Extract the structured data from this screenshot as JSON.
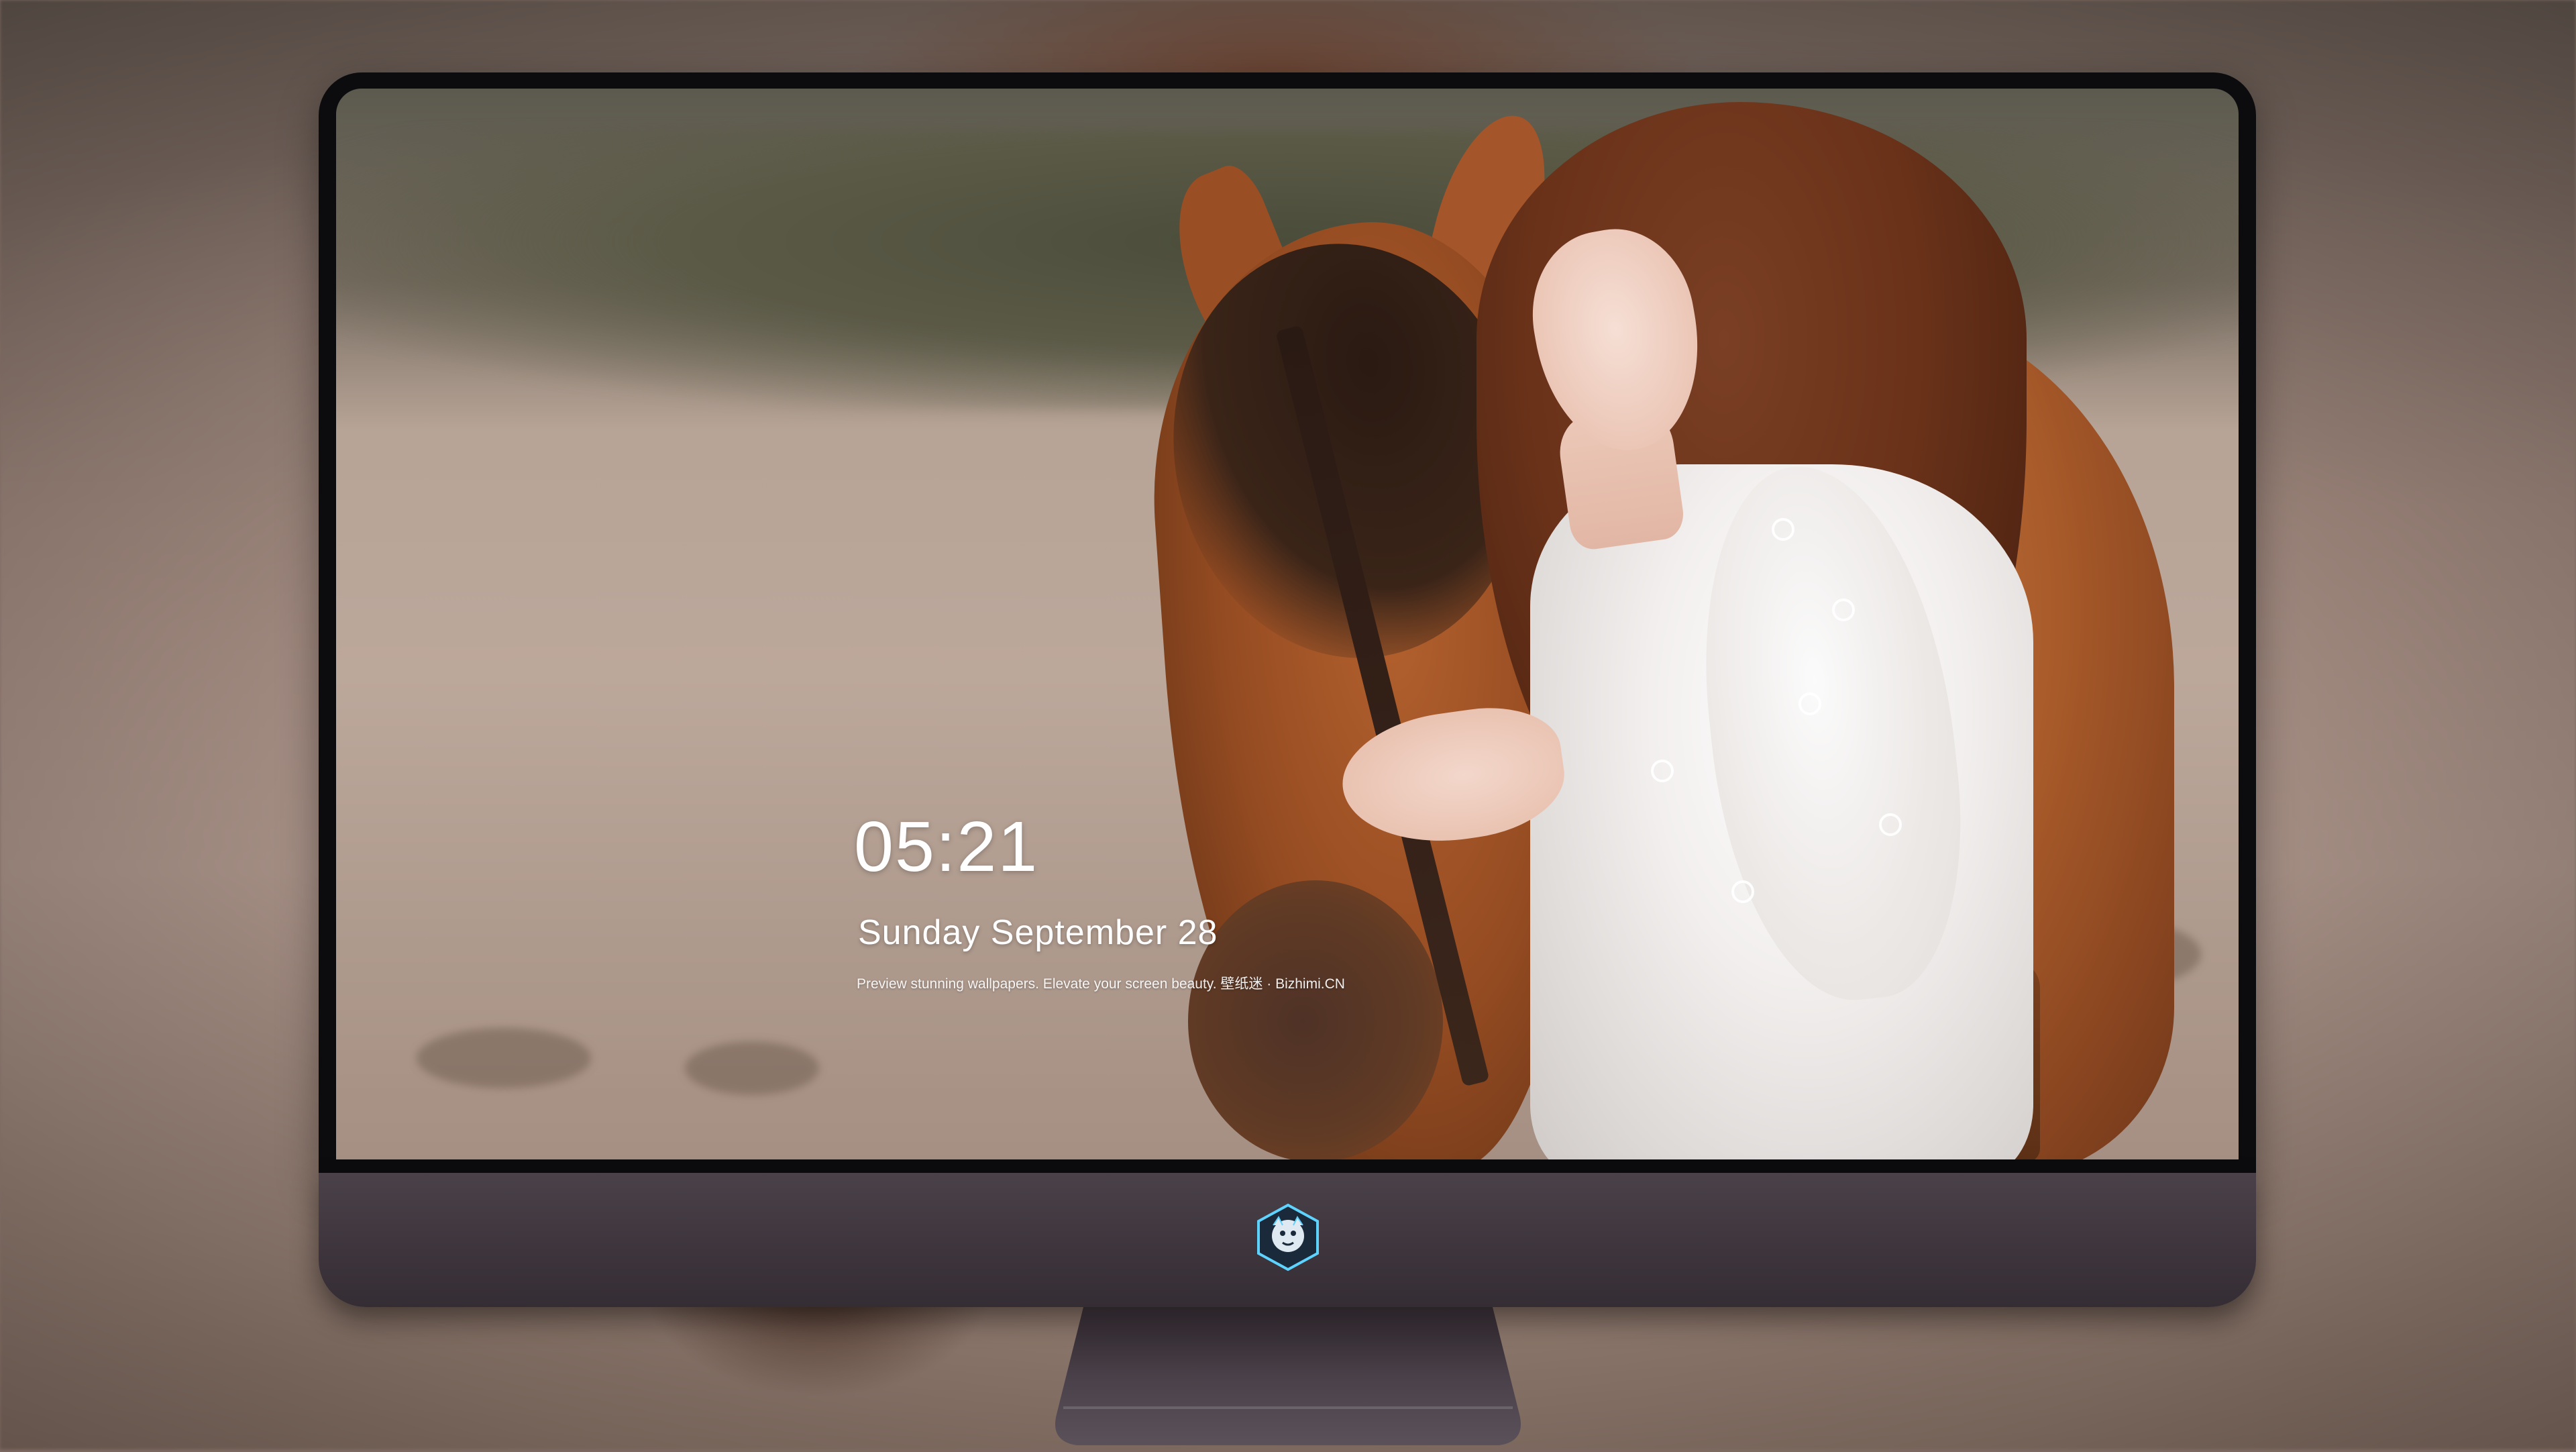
{
  "lockscreen": {
    "time": "05:21",
    "date": "Sunday September 28",
    "caption": "Preview stunning wallpapers. Elevate your screen beauty. 壁纸迷 · Bizhimi.CN"
  },
  "dock": {
    "apps": [
      {
        "name": "messages-icon",
        "color": "#3ed158"
      },
      {
        "name": "weather-icon",
        "color": "#2f8cf2"
      },
      {
        "name": "clock-icon",
        "color": "#1a1a1a"
      },
      {
        "name": "preview-icon",
        "color": "#f5c430"
      },
      {
        "name": "imovie-icon",
        "color": "#5fb3e6"
      },
      {
        "name": "notes-icon",
        "color": "#f7d34a"
      },
      {
        "name": "photos-icon",
        "color": "#4aa0e8"
      },
      {
        "name": "music-icon",
        "color": "#e040c8"
      },
      {
        "name": "app-store-icon",
        "color": "#1d8ef0"
      },
      {
        "name": "camera-icon",
        "color": "#5a5a5e"
      }
    ]
  },
  "colors": {
    "chin": "#3d343c",
    "bezel": "#0c0c0e"
  }
}
